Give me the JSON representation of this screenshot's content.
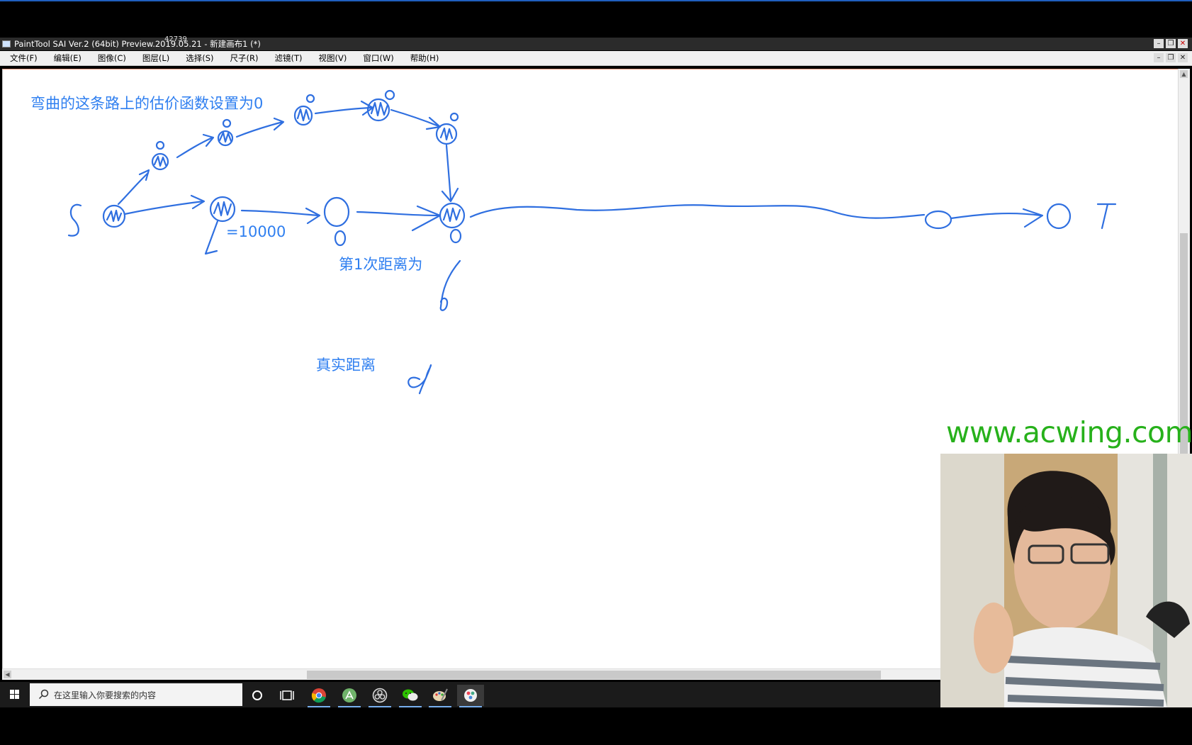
{
  "window": {
    "title": "PaintTool SAI Ver.2 (64bit) Preview.2019.05.21 - 新建画布1 (*)",
    "overlay_number": "42739",
    "controls": {
      "minimize": "–",
      "restore": "❐",
      "close": "✕"
    }
  },
  "menubar": {
    "items": [
      {
        "label": "文件(F)"
      },
      {
        "label": "编辑(E)"
      },
      {
        "label": "图像(C)"
      },
      {
        "label": "图层(L)"
      },
      {
        "label": "选择(S)"
      },
      {
        "label": "尺子(R)"
      },
      {
        "label": "滤镜(T)"
      },
      {
        "label": "视图(V)"
      },
      {
        "label": "窗口(W)"
      },
      {
        "label": "帮助(H)"
      }
    ]
  },
  "canvas": {
    "text_curved_path": "弯曲的这条路上的估价函数设置为0",
    "text_edge_weight": "=10000",
    "text_first_distance": "第1次距离为",
    "text_real_distance": "真实距离",
    "ink_color": "#2f6fe0",
    "text_color": "#2f7ff0"
  },
  "taskbar": {
    "search_placeholder": "在这里输入你要搜索的内容",
    "apps": [
      "cortana-icon",
      "task-view-icon",
      "chrome-icon",
      "app-store-icon",
      "obs-icon",
      "wechat-icon",
      "paint-icon",
      "sai-icon"
    ]
  },
  "overlay": {
    "watermark": "www.acwing.com",
    "watermark_color": "#27b11b"
  }
}
